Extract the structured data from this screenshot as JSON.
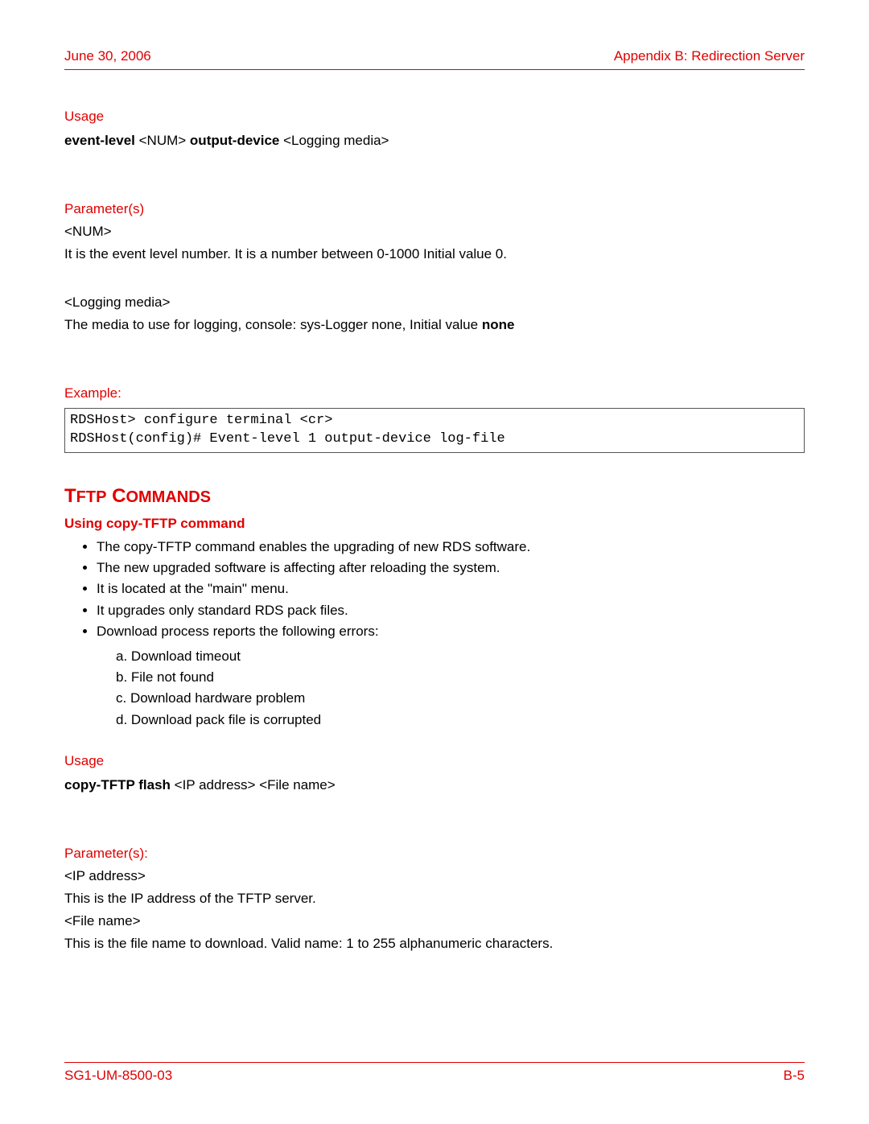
{
  "header": {
    "date": "June 30, 2006",
    "appendix": "Appendix B: Redirection Server"
  },
  "section1": {
    "usage_label": "Usage",
    "usage_bold1": "event-level",
    "usage_plain1": " <NUM> ",
    "usage_bold2": "output-device",
    "usage_plain2": " <Logging media>",
    "params_label": "Parameter(s)",
    "p1_name": "<NUM>",
    "p1_desc": "It is the event level number. It is a number between 0-1000 Initial value 0.",
    "p2_name": "<Logging media>",
    "p2_desc_pre": "The media to use for logging, console: sys-Logger none, Initial value ",
    "p2_desc_bold": "none",
    "example_label": "Example:",
    "code": "RDSHost> configure terminal <cr>\nRDSHost(config)# Event-level 1 output-device log-file"
  },
  "section2": {
    "title_big": "T",
    "title_sc1": "FTP",
    "title_sp": " C",
    "title_sc2": "OMMANDS",
    "subheading": "Using copy-TFTP command",
    "bullets": [
      "The copy-TFTP command enables the upgrading of new RDS software.",
      "The new upgraded software is affecting after reloading the system.",
      "It is located at the \"main\" menu.",
      "It upgrades only standard RDS pack files.",
      "Download process reports the following errors:"
    ],
    "errors": [
      "a. Download timeout",
      "b. File not found",
      "c. Download hardware problem",
      "d. Download pack file is corrupted"
    ],
    "usage_label": "Usage",
    "usage_bold": "copy-TFTP flash",
    "usage_plain": " <IP address> <File name>",
    "params_label": "Parameter(s):",
    "p1_name": "<IP address>",
    "p1_desc": "This is the IP address of the TFTP server.",
    "p2_name": "<File name>",
    "p2_desc": "This is the file name to download. Valid name: 1 to 255 alphanumeric characters."
  },
  "footer": {
    "left": "SG1-UM-8500-03",
    "right": "B-5"
  }
}
